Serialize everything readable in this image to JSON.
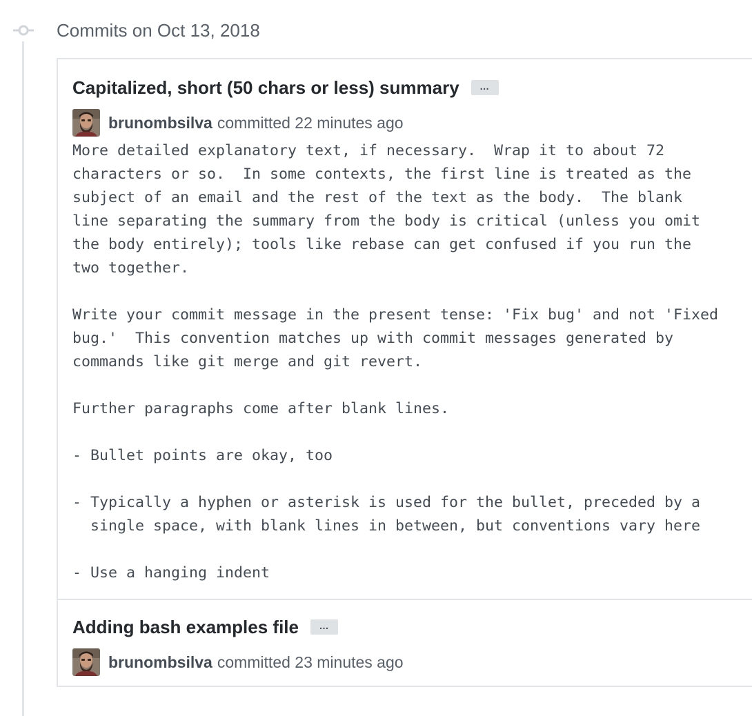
{
  "group": {
    "title": "Commits on Oct 13, 2018"
  },
  "commits": [
    {
      "title": "Capitalized, short (50 chars or less) summary",
      "ellipsis": "…",
      "author": "brunombsilva",
      "committed": "committed 22 minutes ago",
      "body": "More detailed explanatory text, if necessary.  Wrap it to about 72\ncharacters or so.  In some contexts, the first line is treated as the\nsubject of an email and the rest of the text as the body.  The blank\nline separating the summary from the body is critical (unless you omit\nthe body entirely); tools like rebase can get confused if you run the\ntwo together.\n\nWrite your commit message in the present tense: 'Fix bug' and not 'Fixed\nbug.'  This convention matches up with commit messages generated by\ncommands like git merge and git revert.\n\nFurther paragraphs come after blank lines.\n\n- Bullet points are okay, too\n\n- Typically a hyphen or asterisk is used for the bullet, preceded by a\n  single space, with blank lines in between, but conventions vary here\n\n- Use a hanging indent"
    },
    {
      "title": "Adding bash examples file",
      "ellipsis": "…",
      "author": "brunombsilva",
      "committed": "committed 23 minutes ago"
    }
  ],
  "icons": {
    "timeline": "git-commit-icon",
    "avatar": "user-avatar-icon"
  },
  "colors": {
    "title_text": "#24292e",
    "muted_text": "#586069",
    "border": "#e1e4e8",
    "ellipsis_bg": "#dfe2e5"
  }
}
